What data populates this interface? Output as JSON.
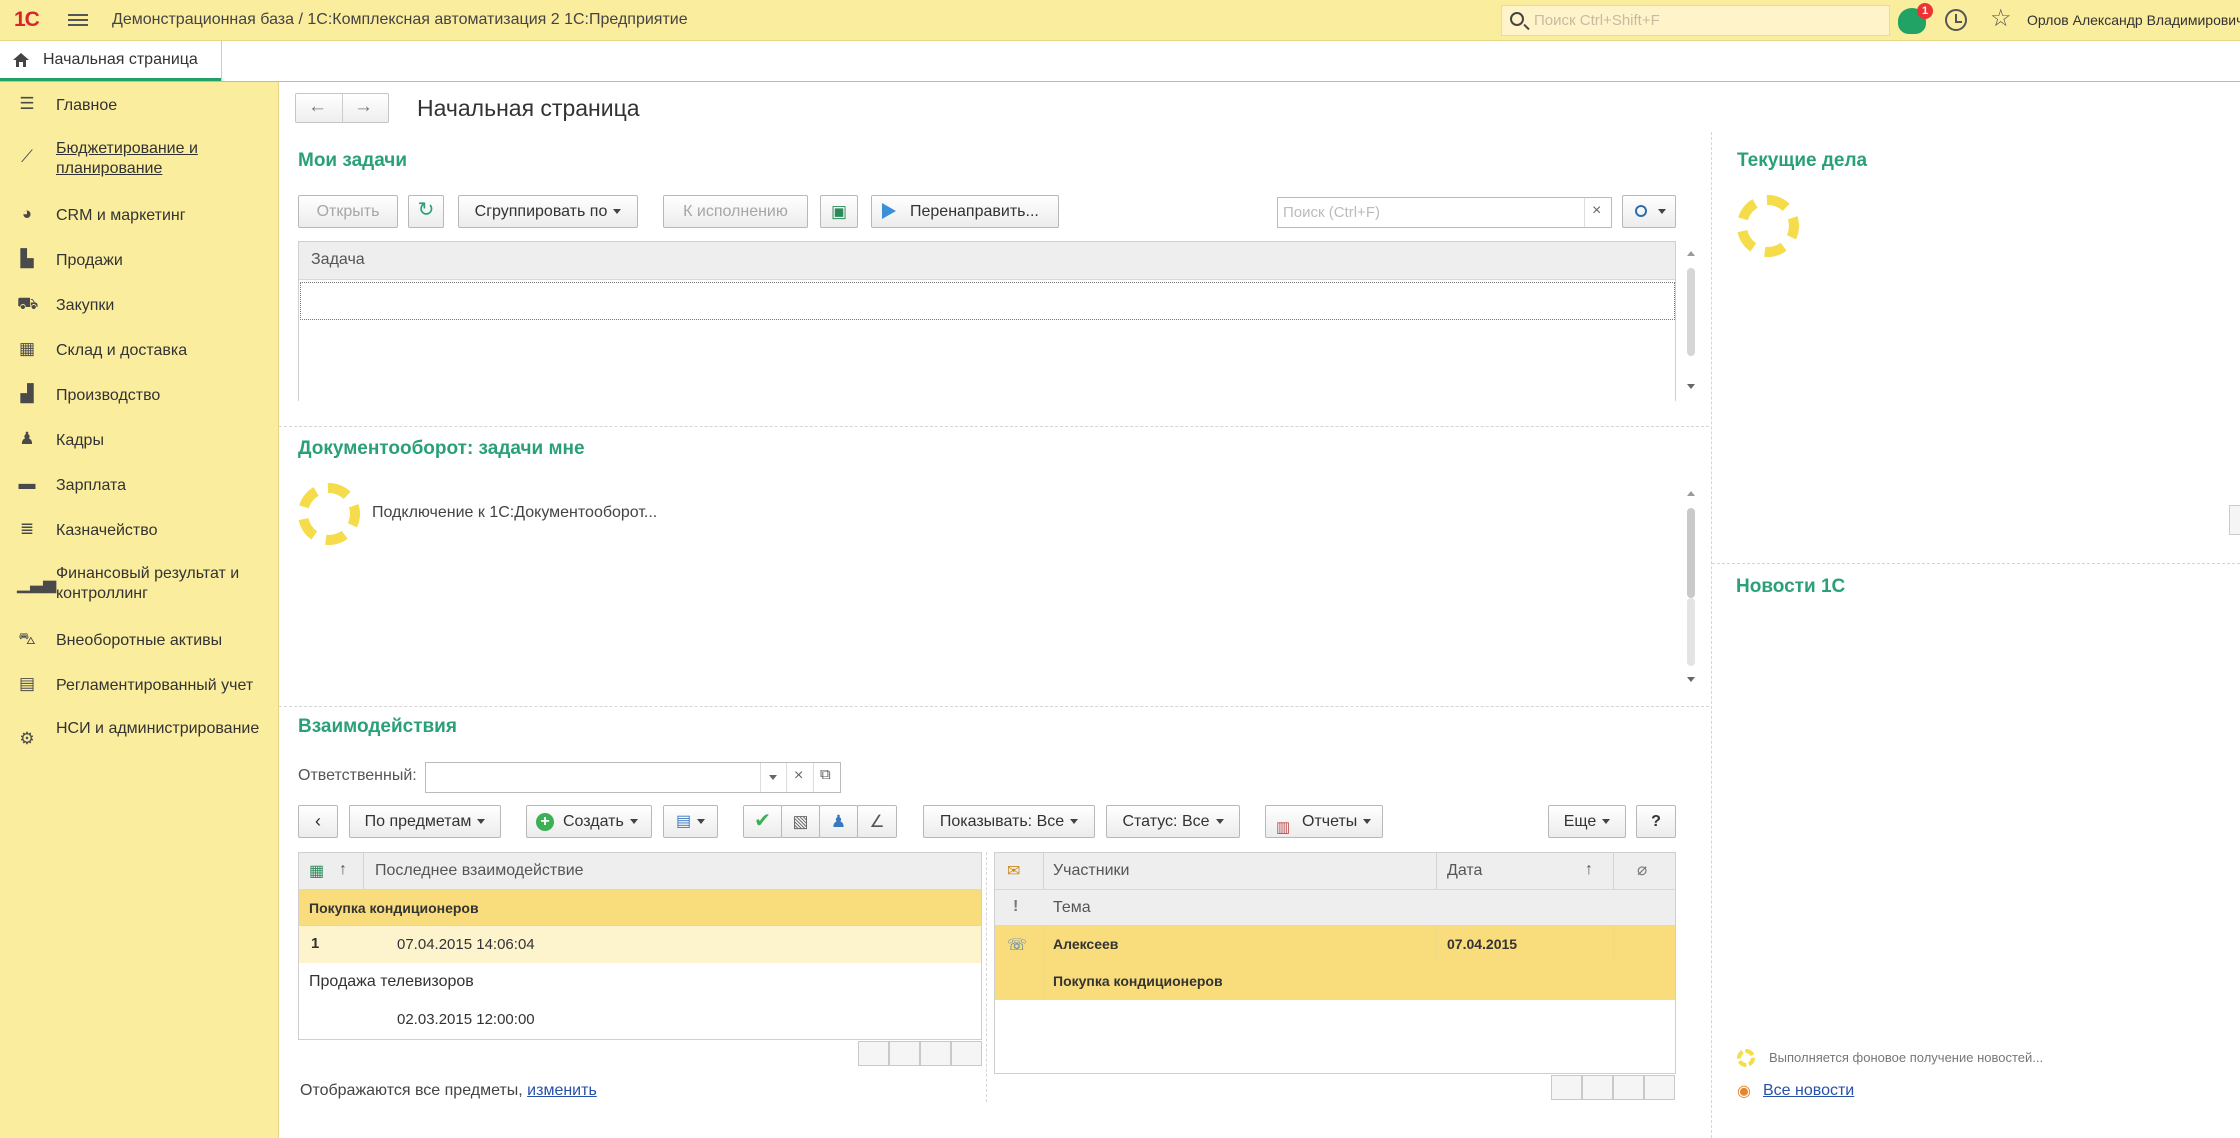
{
  "app": {
    "logo": "1С",
    "title": "Демонстрационная база / 1С:Комплексная автоматизация 2 1С:Предприятие",
    "search_placeholder": "Поиск Ctrl+Shift+F",
    "notifications_count": "1",
    "user": "Орлов Александр Владимирович"
  },
  "tabs": [
    {
      "label": "Начальная страница"
    }
  ],
  "sidebar": {
    "items": [
      {
        "label": "Главное",
        "icon": "menu-lines-icon"
      },
      {
        "label": "Бюджетирование и планирование",
        "icon": "chart-trend-icon"
      },
      {
        "label": "CRM и маркетинг",
        "icon": "pie-icon"
      },
      {
        "label": "Продажи",
        "icon": "bag-icon"
      },
      {
        "label": "Закупки",
        "icon": "cart-icon"
      },
      {
        "label": "Склад и доставка",
        "icon": "grid-icon"
      },
      {
        "label": "Производство",
        "icon": "factory-icon"
      },
      {
        "label": "Кадры",
        "icon": "person-icon"
      },
      {
        "label": "Зарплата",
        "icon": "card-icon"
      },
      {
        "label": "Казначейство",
        "icon": "coins-icon"
      },
      {
        "label": "Финансовый результат и контроллинг",
        "icon": "bar-chart-icon"
      },
      {
        "label": "Внеоборотные активы",
        "icon": "truck-icon"
      },
      {
        "label": "Регламентированный учет",
        "icon": "calculator-icon"
      },
      {
        "label": "НСИ и администрирование",
        "icon": "gear-icon"
      }
    ]
  },
  "page": {
    "title": "Начальная страница"
  },
  "my_tasks": {
    "title": "Мои задачи",
    "buttons": {
      "open": "Открыть",
      "group_by": "Сгруппировать по",
      "to_execute": "К исполнению",
      "redirect": "Перенаправить..."
    },
    "search_placeholder": "Поиск (Ctrl+F)",
    "column": "Задача"
  },
  "docflow": {
    "title": "Документооборот: задачи мне",
    "status": "Подключение к 1С:Документооборот..."
  },
  "interactions": {
    "title": "Взаимодействия",
    "responsible_label": "Ответственный:",
    "buttons": {
      "by_subjects": "По предметам",
      "create": "Создать",
      "show": "Показывать: Все",
      "status": "Статус: Все",
      "reports": "Отчеты",
      "more": "Еще",
      "help": "?"
    },
    "left_table": {
      "sort_arrow": "↑",
      "column": "Последнее взаимодействие",
      "groups": [
        {
          "subject": "Покупка кондиционеров",
          "count": "1",
          "date": "07.04.2015 14:06:04"
        },
        {
          "subject": "Продажа телевизоров",
          "count": "",
          "date": "02.03.2015 12:00:00"
        }
      ]
    },
    "right_table": {
      "col_participants": "Участники",
      "col_date": "Дата",
      "sort_arrow": "↑",
      "col_importance": "!",
      "col_topic": "Тема",
      "rows": [
        {
          "participants": "Алексеев",
          "date": "07.04.2015",
          "topic": "Покупка кондиционеров"
        }
      ]
    },
    "footer_text": "Отображаются все предметы,",
    "footer_link": "изменить"
  },
  "current_affairs": {
    "title": "Текущие дела"
  },
  "news": {
    "title": "Новости 1С",
    "loading": "Выполняется фоновое получение новостей...",
    "all_news": "Все новости"
  },
  "colors": {
    "accent_green": "#2aa07a",
    "topbar_yellow": "#fbed9e",
    "selection_yellow": "#f9dd7d",
    "logo_red": "#d9262c"
  }
}
